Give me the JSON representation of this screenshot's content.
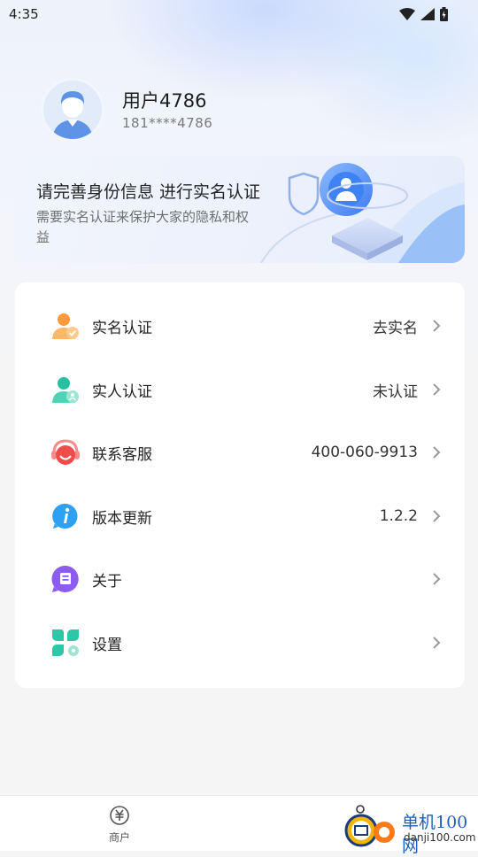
{
  "status_bar": {
    "time": "4:35"
  },
  "profile": {
    "name": "用户4786",
    "phone": "181****4786"
  },
  "banner": {
    "title": "请完善身份信息 进行实名认证",
    "description": "需要实名认证来保护大家的隐私和权益"
  },
  "menu": {
    "items": [
      {
        "label": "实名认证",
        "value": "去实名",
        "icon": "user-verify-icon"
      },
      {
        "label": "实人认证",
        "value": "未认证",
        "icon": "face-verify-icon"
      },
      {
        "label": "联系客服",
        "value": "400-060-9913",
        "icon": "headset-icon"
      },
      {
        "label": "版本更新",
        "value": "1.2.2",
        "icon": "info-icon"
      },
      {
        "label": "关于",
        "value": "",
        "icon": "about-icon"
      },
      {
        "label": "设置",
        "value": "",
        "icon": "settings-icon"
      }
    ]
  },
  "bottom_nav": {
    "merchant_label": "商户"
  },
  "watermark": {
    "brand": "单机100网",
    "domain": "danji100.com"
  }
}
